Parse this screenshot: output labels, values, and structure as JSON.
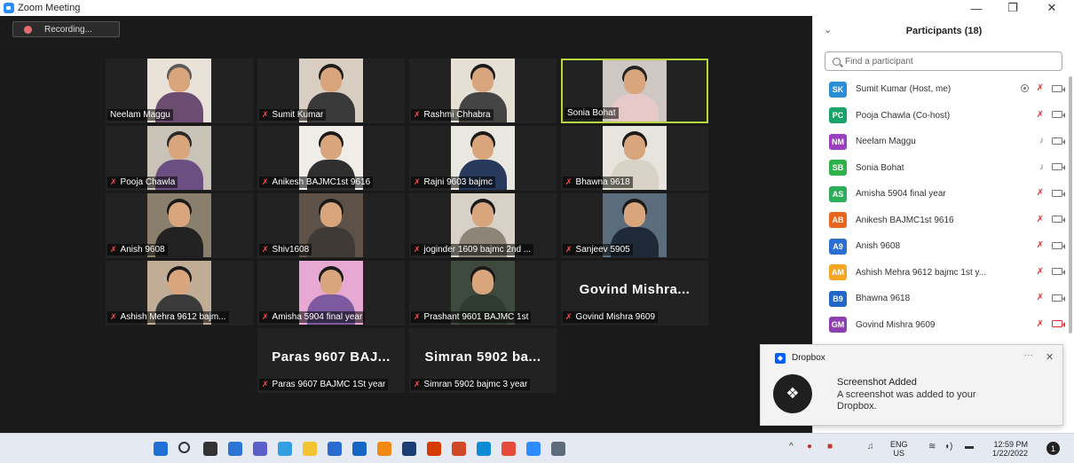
{
  "window": {
    "title": "Zoom Meeting",
    "minimize_glyph": "—",
    "maximize_glyph": "❐",
    "close_glyph": "✕"
  },
  "recording": {
    "label": "Recording..."
  },
  "participants_panel": {
    "title": "Participants (18)",
    "collapse_glyph": "⌄",
    "search_placeholder": "Find a participant",
    "participants": [
      {
        "initials": "SK",
        "name": "Sumit Kumar (Host, me)",
        "color": "#2d8cd6",
        "mic": "muted",
        "cam": "on",
        "recording": true
      },
      {
        "initials": "PC",
        "name": "Pooja Chawla (Co-host)",
        "color": "#1aa36b",
        "mic": "muted",
        "cam": "on"
      },
      {
        "initials": "NM",
        "name": "Neelam Maggu",
        "color": "#9b3fbf",
        "mic": "on",
        "cam": "on"
      },
      {
        "initials": "SB",
        "name": "Sonia Bohat",
        "color": "#2fb24c",
        "mic": "on",
        "cam": "on"
      },
      {
        "initials": "AS",
        "name": "Amisha 5904 final year",
        "color": "#2eae5a",
        "mic": "muted",
        "cam": "on"
      },
      {
        "initials": "AB",
        "name": "Anikesh BAJMC1st 9616",
        "color": "#e8651e",
        "mic": "muted",
        "cam": "on"
      },
      {
        "initials": "A9",
        "name": "Anish 9608",
        "color": "#2c6fd1",
        "mic": "muted",
        "cam": "on"
      },
      {
        "initials": "AM",
        "name": "Ashish Mehra 9612 bajmc 1st y...",
        "color": "#f5a623",
        "mic": "muted",
        "cam": "on"
      },
      {
        "initials": "B9",
        "name": "Bhawna 9618",
        "color": "#2366c9",
        "mic": "muted",
        "cam": "on"
      },
      {
        "initials": "GM",
        "name": "Govind Mishra 9609",
        "color": "#8e3fb0",
        "mic": "muted",
        "cam": "off"
      }
    ]
  },
  "video_tiles": [
    {
      "name": "Neelam Maggu",
      "muted": false,
      "bg": "#e9e2d8",
      "hair": "#5a5a5a",
      "body": "#6d4c72"
    },
    {
      "name": "Sumit Kumar",
      "muted": true,
      "bg": "#d8cfc2",
      "hair": "#1b1b1b",
      "body": "#3a3a3a"
    },
    {
      "name": "Rashmi Chhabra",
      "muted": true,
      "bg": "#e6dfd4",
      "hair": "#1a1a1a",
      "body": "#444"
    },
    {
      "name": "Sonia Bohat",
      "muted": false,
      "active": true,
      "bg": "#cfc7c4",
      "hair": "#222",
      "body": "#e8c9c9"
    },
    {
      "name": "Pooja Chawla",
      "muted": true,
      "bg": "#c9c2b6",
      "hair": "#2a2a2a",
      "body": "#6b4f82"
    },
    {
      "name": "Anikesh BAJMC1st 9616",
      "muted": true,
      "bg": "#f0ede8",
      "hair": "#1a1a1a",
      "body": "#2f2f2f"
    },
    {
      "name": "Rajni 9603 bajmc",
      "muted": true,
      "bg": "#eae6e0",
      "hair": "#1a1a1a",
      "body": "#273a5c"
    },
    {
      "name": "Bhawna 9618",
      "muted": true,
      "bg": "#e7e4de",
      "hair": "#1a1a1a",
      "body": "#d9d2c6"
    },
    {
      "name": "Anish 9608",
      "muted": true,
      "bg": "#8a7f6c",
      "hair": "#1a1a1a",
      "body": "#222"
    },
    {
      "name": "Shiv1608",
      "muted": true,
      "bg": "#5d5148",
      "hair": "#1a1a1a",
      "body": "#3f3a36"
    },
    {
      "name": "joginder 1609 bajmc 2nd ...",
      "muted": true,
      "bg": "#d7d1c7",
      "hair": "#1a1a1a",
      "body": "#8c8578"
    },
    {
      "name": "Sanjeev 5905",
      "muted": true,
      "bg": "#5b6d7c",
      "hair": "#1a1a1a",
      "body": "#1e2a38"
    },
    {
      "name": "Ashish Mehra 9612 bajm...",
      "muted": true,
      "bg": "#c1ad96",
      "hair": "#1a1a1a",
      "body": "#3b3b3b"
    },
    {
      "name": "Amisha 5904 final year",
      "muted": true,
      "bg": "#e8a8d4",
      "hair": "#1a1a1a",
      "body": "#7d5aa0"
    },
    {
      "name": "Prashant 9601 BAJMC 1st",
      "muted": true,
      "bg": "#3f4a3e",
      "hair": "#1a1a1a",
      "body": "#2f3a30"
    },
    {
      "name": "Govind Mishra 9609",
      "muted": true,
      "text_only": "Govind Mishra..."
    },
    {
      "name": "Paras 9607 BAJMC 1St year",
      "muted": true,
      "text_only": "Paras 9607 BAJ..."
    },
    {
      "name": "Simran 5902 bajmc 3 year",
      "muted": true,
      "text_only": "Simran 5902 ba..."
    }
  ],
  "toast": {
    "app": "Dropbox",
    "title": "Screenshot Added",
    "body": "A screenshot was added to your Dropbox.",
    "more_glyph": "···",
    "close_glyph": "✕"
  },
  "taskbar": {
    "apps": [
      {
        "name": "start-icon",
        "color": "#1f6fd6"
      },
      {
        "name": "search-icon",
        "color": "#333333"
      },
      {
        "name": "task-view-icon",
        "color": "#333333"
      },
      {
        "name": "widgets-icon",
        "color": "#2a74d6"
      },
      {
        "name": "chat-icon",
        "color": "#5b5fc7"
      },
      {
        "name": "ie-icon",
        "color": "#32a0e0"
      },
      {
        "name": "file-explorer-icon",
        "color": "#f4c430"
      },
      {
        "name": "store-icon",
        "color": "#2a6bd1"
      },
      {
        "name": "mail-icon",
        "color": "#1664c4"
      },
      {
        "name": "vlc-icon",
        "color": "#f08a12"
      },
      {
        "name": "app-icon",
        "color": "#1b3d75"
      },
      {
        "name": "office-icon",
        "color": "#d83b01"
      },
      {
        "name": "powerpoint-icon",
        "color": "#d24726"
      },
      {
        "name": "edge-icon",
        "color": "#0f8bd6"
      },
      {
        "name": "chrome-icon",
        "color": "#e64a3b"
      },
      {
        "name": "zoom-icon",
        "color": "#2d8cff"
      },
      {
        "name": "settings-icon",
        "color": "#5d6b7a"
      }
    ],
    "language": "ENG",
    "region": "US",
    "time": "12:59 PM",
    "date": "1/22/2022",
    "notification_count": "1"
  }
}
